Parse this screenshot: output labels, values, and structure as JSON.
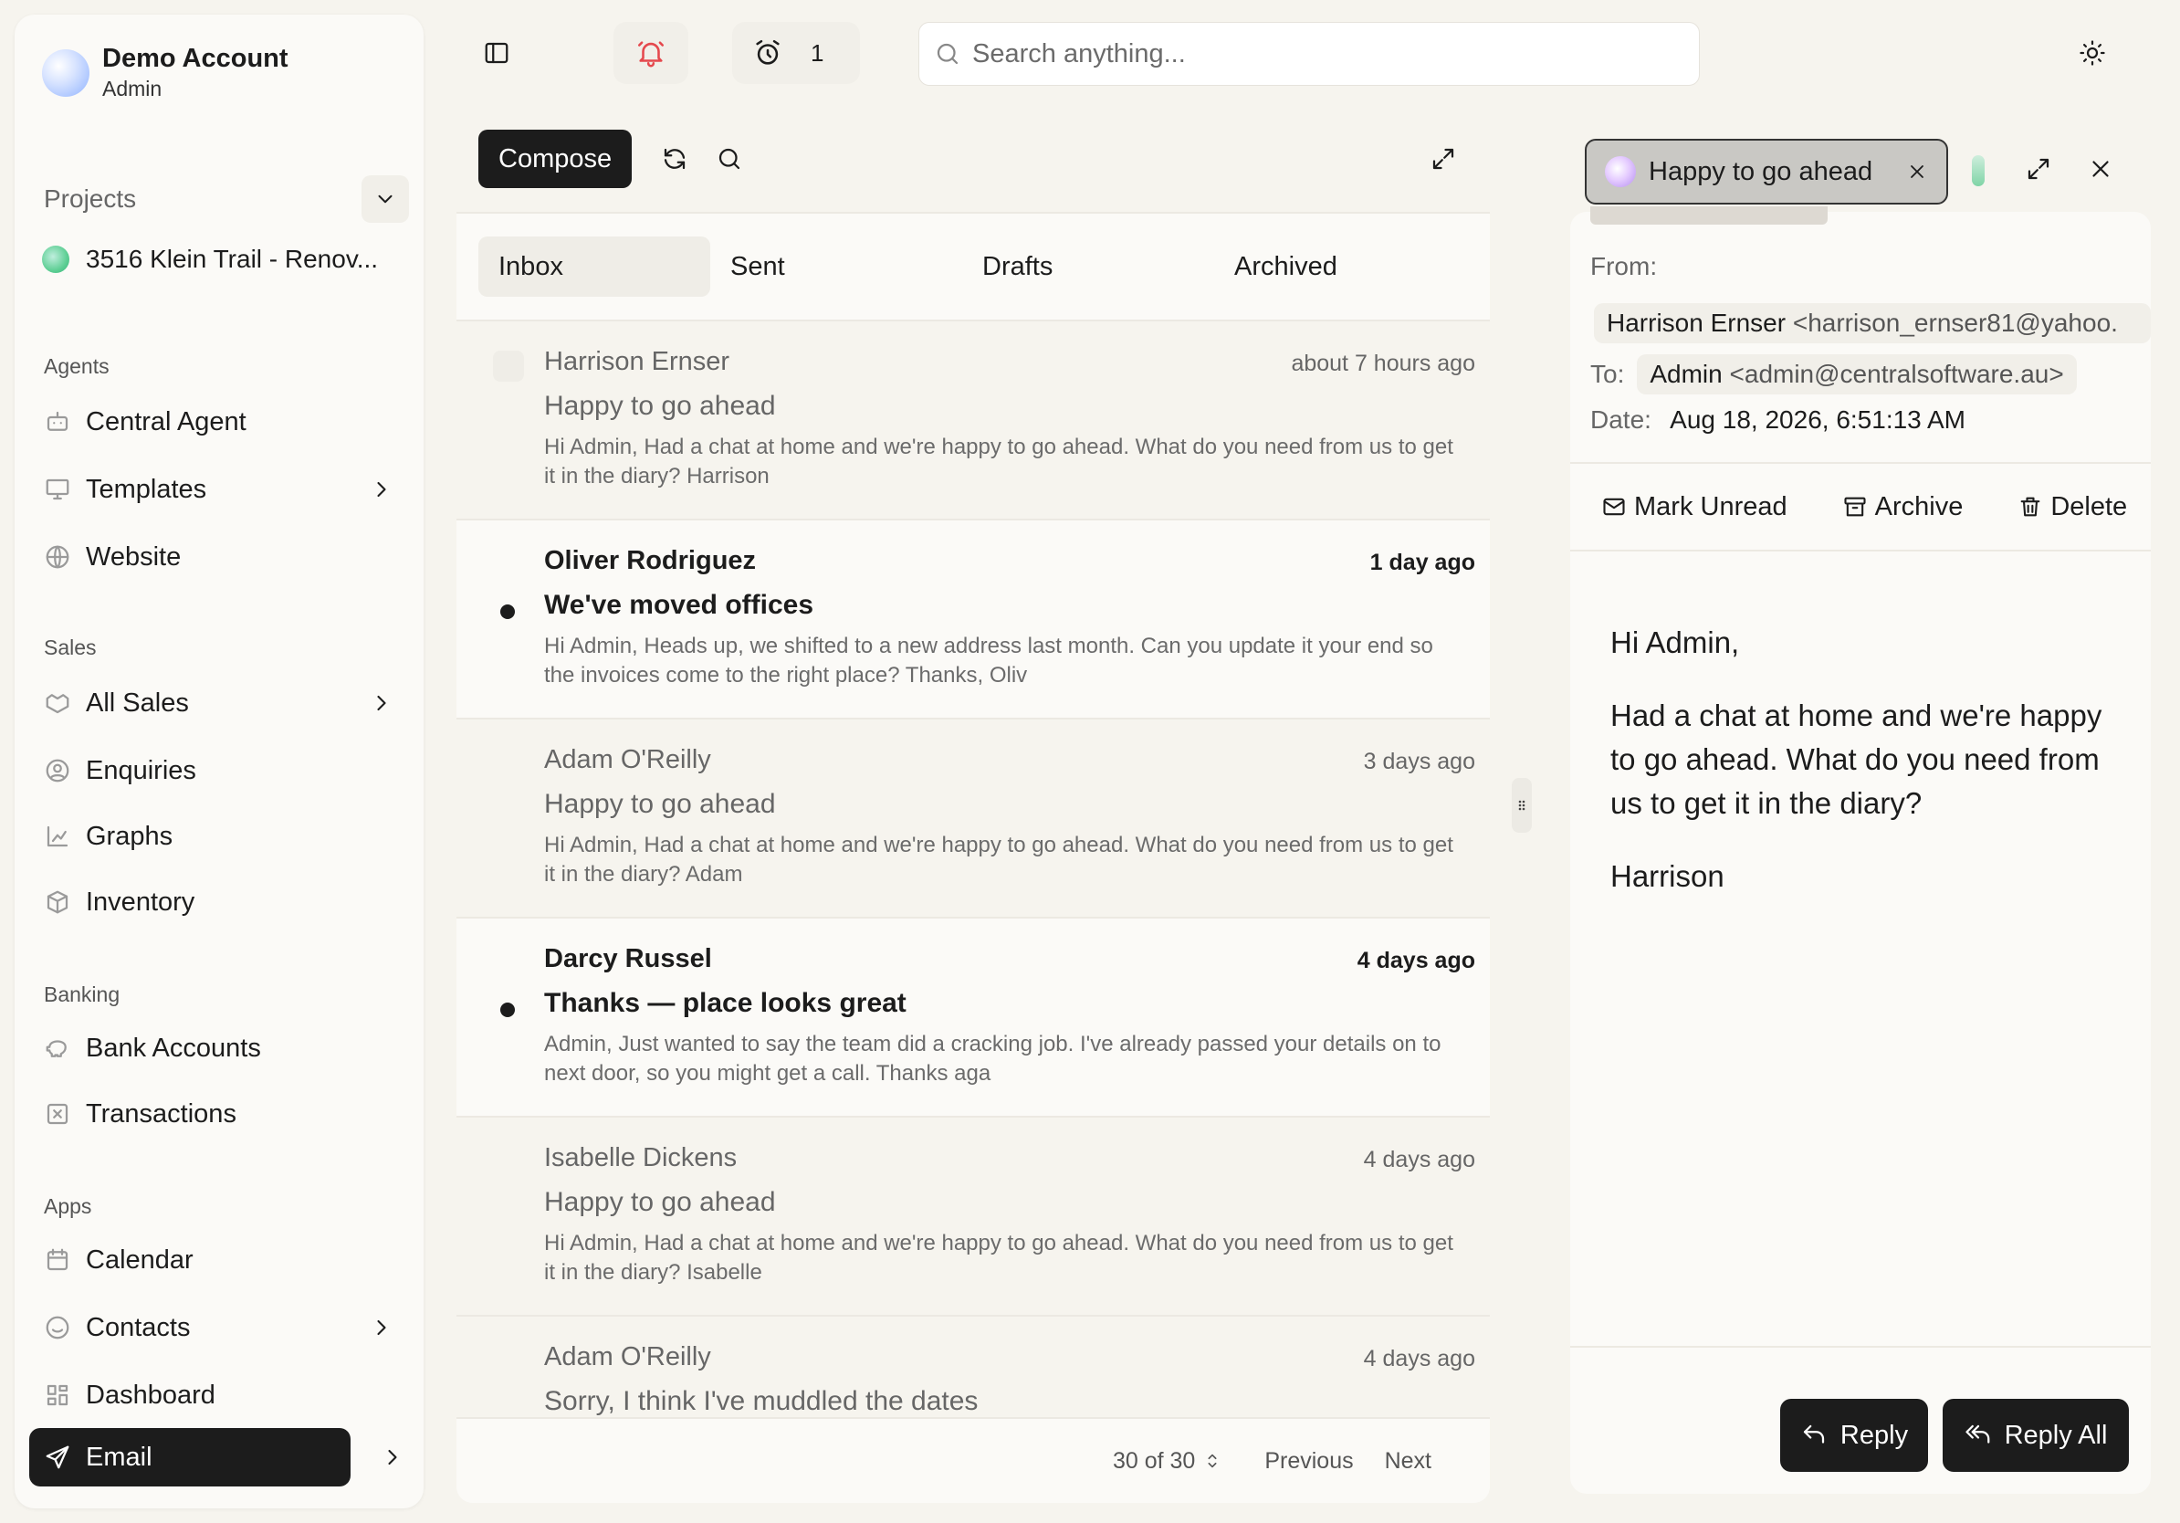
{
  "account": {
    "name": "Demo Account",
    "role": "Admin"
  },
  "projects": {
    "label": "Projects",
    "current": "3516 Klein Trail - Renov..."
  },
  "sidebar": {
    "agents": {
      "heading": "Agents",
      "items": [
        "Central Agent",
        "Templates",
        "Website"
      ]
    },
    "sales": {
      "heading": "Sales",
      "items": [
        "All Sales",
        "Enquiries",
        "Graphs",
        "Inventory"
      ]
    },
    "banking": {
      "heading": "Banking",
      "items": [
        "Bank Accounts",
        "Transactions"
      ]
    },
    "apps": {
      "heading": "Apps",
      "items": [
        "Calendar",
        "Contacts",
        "Dashboard",
        "Email"
      ]
    }
  },
  "topbar": {
    "alarm_count": "1",
    "search_placeholder": "Search anything..."
  },
  "mail": {
    "compose_label": "Compose",
    "tabs": [
      "Inbox",
      "Sent",
      "Drafts",
      "Archived"
    ],
    "items": [
      {
        "from": "Harrison Ernser",
        "time": "about 7 hours ago",
        "subject": "Happy to go ahead",
        "preview": "Hi Admin, Had a chat at home and we're happy to go ahead. What do you need from us to get it in the diary? Harrison"
      },
      {
        "from": "Oliver Rodriguez",
        "time": "1 day ago",
        "subject": "We've moved offices",
        "preview": "Hi Admin, Heads up, we shifted to a new address last month. Can you update it your end so the invoices come to the right place? Thanks, Oliv"
      },
      {
        "from": "Adam O'Reilly",
        "time": "3 days ago",
        "subject": "Happy to go ahead",
        "preview": "Hi Admin, Had a chat at home and we're happy to go ahead. What do you need from us to get it in the diary? Adam"
      },
      {
        "from": "Darcy Russel",
        "time": "4 days ago",
        "subject": "Thanks — place looks great",
        "preview": "Admin, Just wanted to say the team did a cracking job. I've already passed your details on to next door, so you might get a call. Thanks aga"
      },
      {
        "from": "Isabelle Dickens",
        "time": "4 days ago",
        "subject": "Happy to go ahead",
        "preview": "Hi Admin, Had a chat at home and we're happy to go ahead. What do you need from us to get it in the diary? Isabelle"
      },
      {
        "from": "Adam O'Reilly",
        "time": "4 days ago",
        "subject": "Sorry, I think I've muddled the dates",
        "preview": ""
      }
    ],
    "pager": {
      "count": "30 of 30",
      "previous": "Previous",
      "next": "Next"
    }
  },
  "detail": {
    "tab_title": "Happy to go ahead",
    "from_label": "From:",
    "from_name": "Harrison Ernser",
    "from_email": "<harrison_ernser81@yahoo.",
    "to_label": "To:",
    "to_name": "Admin",
    "to_email": "<admin@centralsoftware.au>",
    "date_label": "Date:",
    "date_value": "Aug 18, 2026, 6:51:13 AM",
    "actions": {
      "mark_unread": "Mark Unread",
      "archive": "Archive",
      "delete": "Delete"
    },
    "body": [
      "Hi Admin,",
      "Had a chat at home and we're happy to go ahead. What do you need from us to get it in the diary?",
      "Harrison"
    ],
    "reply_label": "Reply",
    "reply_all_label": "Reply All"
  },
  "colors": {
    "background": "#f6f4ee",
    "panel": "#fbfaf7",
    "dark": "#1c1c1c",
    "alert": "#e5484d"
  }
}
